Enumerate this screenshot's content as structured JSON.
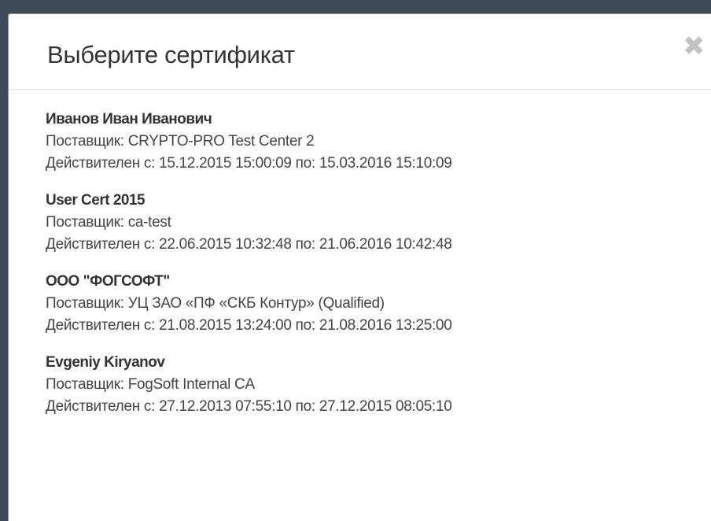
{
  "modal": {
    "title": "Выберите сертификат",
    "close_symbol": "✖"
  },
  "certificates": [
    {
      "name": "Иванов Иван Иванович",
      "issuer": "Поставщик: CRYPTO-PRO Test Center 2",
      "validity": "Действителен с: 15.12.2015 15:00:09 по: 15.03.2016 15:10:09"
    },
    {
      "name": "User Cert 2015",
      "issuer": "Поставщик: ca-test",
      "validity": "Действителен с: 22.06.2015 10:32:48 по: 21.06.2016 10:42:48"
    },
    {
      "name": "ООО \"ФОГСОФТ\"",
      "issuer": "Поставщик: УЦ ЗАО «ПФ «СКБ Контур» (Qualified)",
      "validity": "Действителен с: 21.08.2015 13:24:00 по: 21.08.2016 13:25:00"
    },
    {
      "name": "Evgeniy Kiryanov",
      "issuer": "Поставщик: FogSoft Internal CA",
      "validity": "Действителен с: 27.12.2013 07:55:10 по: 27.12.2015 08:05:10"
    }
  ]
}
